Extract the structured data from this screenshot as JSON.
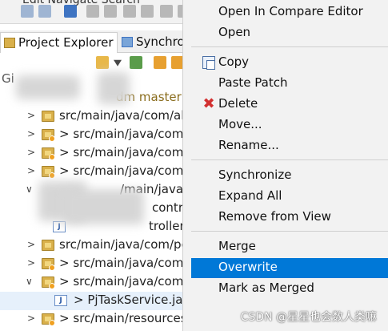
{
  "toolbar": {
    "menu_fragment": "Edit  Navigate  Search"
  },
  "tabs": [
    {
      "label": "Project Explorer"
    },
    {
      "label": "Synchro"
    }
  ],
  "tree": {
    "project_decoration": "dm master",
    "rows": [
      {
        "label": "src/main/java/com/ali"
      },
      {
        "label": "> src/main/java/com/"
      },
      {
        "label": "> src/main/java/com/"
      },
      {
        "label": "> src/main/java/com/"
      },
      {
        "label": "/main/java/com/"
      },
      {
        "label": "contr"
      },
      {
        "label": "troller"
      },
      {
        "label": "src/main/java/com/pe"
      },
      {
        "label": "> src/main/java/com/"
      },
      {
        "label": "> src/main/java/com/"
      },
      {
        "label": "> PjTaskService.java"
      },
      {
        "label": "> src/main/resources"
      }
    ],
    "partial_label": "Gi"
  },
  "context_menu": {
    "items": [
      {
        "label": "Open In Compare Editor",
        "icon": ""
      },
      {
        "label": "Open",
        "icon": ""
      },
      {
        "label": "Copy",
        "icon": "copy-icon"
      },
      {
        "label": "Paste Patch",
        "icon": ""
      },
      {
        "label": "Delete",
        "icon": "delete-icon"
      },
      {
        "label": "Move...",
        "icon": ""
      },
      {
        "label": "Rename...",
        "icon": ""
      },
      {
        "label": "Synchronize",
        "icon": ""
      },
      {
        "label": "Expand All",
        "icon": ""
      },
      {
        "label": "Remove from View",
        "icon": ""
      },
      {
        "label": "Merge",
        "icon": ""
      },
      {
        "label": "Overwrite",
        "icon": ""
      },
      {
        "label": "Mark as Merged",
        "icon": ""
      }
    ],
    "highlighted": "Overwrite"
  },
  "watermark": "CSDN @星星也会数人类嘛",
  "colors": {
    "highlight": "#0078d7",
    "delete": "#d23030",
    "package": "#d9b04b",
    "decoration": "#8a6d1e"
  }
}
